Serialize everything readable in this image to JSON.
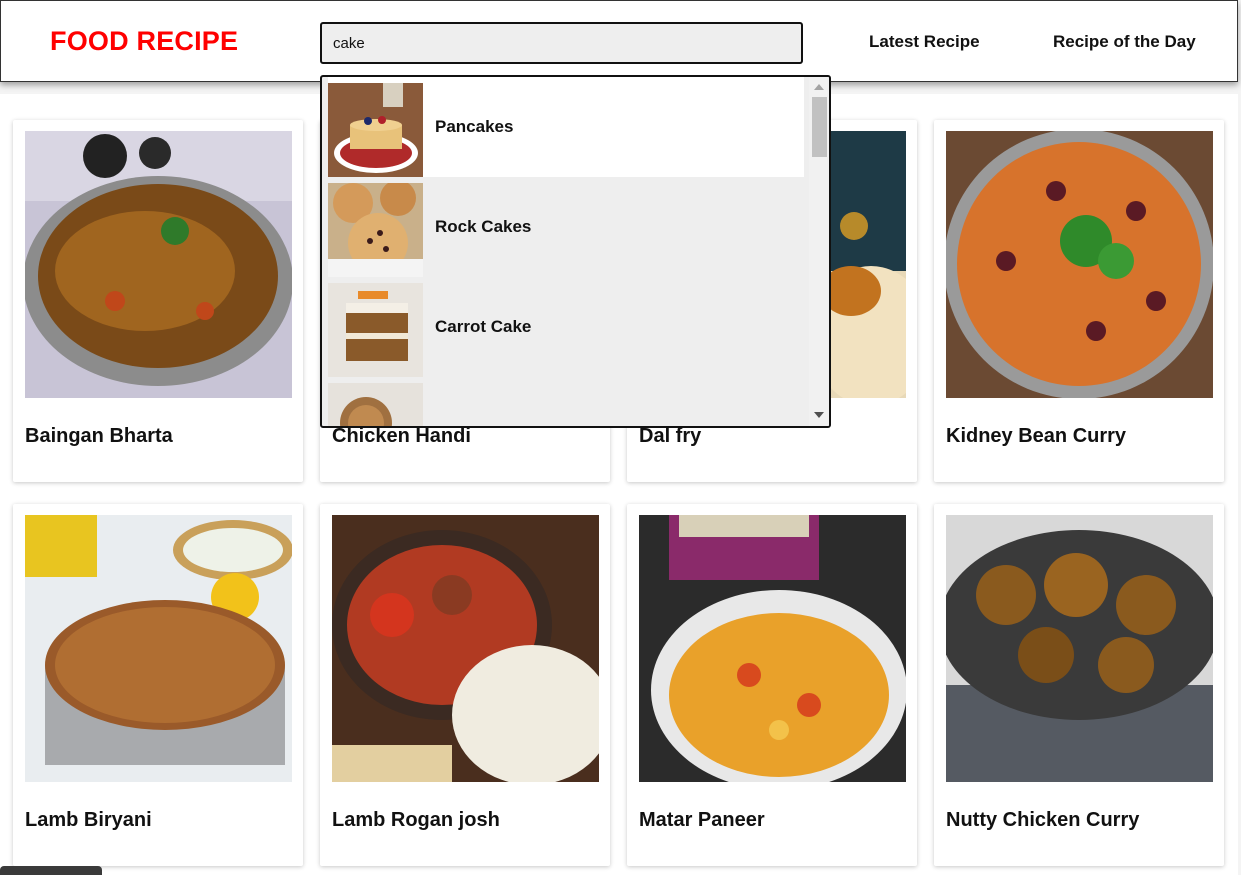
{
  "header": {
    "logo": "FOOD RECIPE",
    "search_value": "cake",
    "nav": {
      "latest": "Latest Recipe",
      "recipe_of_day": "Recipe of the Day"
    }
  },
  "search_results": [
    {
      "name": "Pancakes",
      "icon": "pancakes-thumbnail"
    },
    {
      "name": "Rock Cakes",
      "icon": "rock-cakes-thumbnail"
    },
    {
      "name": "Carrot Cake",
      "icon": "carrot-cake-thumbnail"
    },
    {
      "name": "",
      "icon": "partially-visible-thumbnail"
    }
  ],
  "recipes": [
    {
      "title": "Baingan Bharta"
    },
    {
      "title": "Chicken Handi"
    },
    {
      "title": "Dal fry"
    },
    {
      "title": "Kidney Bean Curry"
    },
    {
      "title": "Lamb Biryani"
    },
    {
      "title": "Lamb Rogan josh"
    },
    {
      "title": "Matar Paneer"
    },
    {
      "title": "Nutty Chicken Curry"
    }
  ],
  "colors": {
    "brand": "#ff0000",
    "search_bg": "#eeeeee",
    "text": "#111111"
  }
}
